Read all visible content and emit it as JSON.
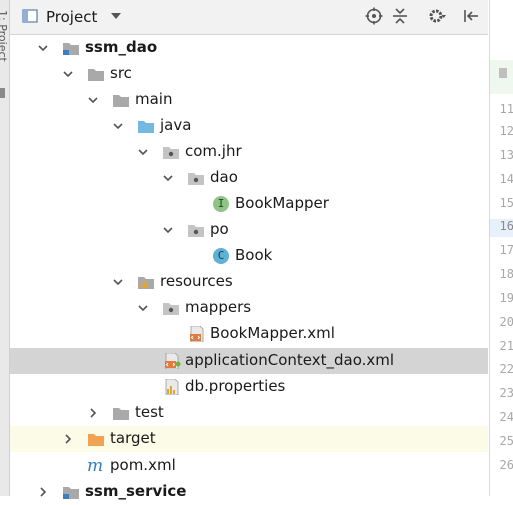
{
  "toolbar": {
    "title": "Project",
    "icons": [
      "project-icon",
      "dropdown-icon",
      "crosshair-icon",
      "collapse-icon",
      "gear-icon",
      "hide-panel-icon"
    ]
  },
  "side_tab": {
    "label": "1: Project"
  },
  "tree": {
    "ssm_dao": "ssm_dao",
    "src": "src",
    "main": "main",
    "java": "java",
    "com_jhr": "com.jhr",
    "dao": "dao",
    "book_mapper": "BookMapper",
    "book_mapper_badge": "I",
    "po": "po",
    "book": "Book",
    "book_badge": "C",
    "resources": "resources",
    "mappers": "mappers",
    "book_mapper_xml": "BookMapper.xml",
    "application_context": "applicationContext_dao.xml",
    "db_properties": "db.properties",
    "test": "test",
    "target": "target",
    "pom_xml": "pom.xml",
    "pom_badge": "m",
    "ssm_service": "ssm_service"
  },
  "gutter": {
    "line_numbers": [
      "11",
      "12",
      "13",
      "14",
      "15",
      "16",
      "17",
      "18",
      "19",
      "20",
      "21",
      "22",
      "23",
      "24",
      "25",
      "26"
    ],
    "current_line": "16"
  },
  "colors": {
    "selection": "#d4d4d4",
    "folder_gray": "#a9a9a9",
    "folder_blue": "#74b8e2",
    "folder_orange": "#f0a451",
    "interface_green": "#8fc387",
    "class_blue": "#5fb1d6",
    "maven_blue": "#2f7ec1"
  }
}
